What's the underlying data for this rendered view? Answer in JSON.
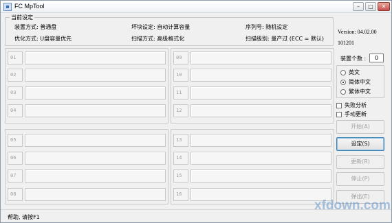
{
  "window": {
    "title": "FC MpTool",
    "controls": {
      "minimize": "–",
      "maximize": "□",
      "close": "✕"
    }
  },
  "settings_group": {
    "legend": "当前设定",
    "install_mode": "装置方式: 普通盘",
    "bad_block": "坏块设定: 自动计算容量",
    "serial": "序列号: 随机设定",
    "optimize": "优化方式: U盘容量优先",
    "scan_mode": "扫描方式: 高级格式化",
    "scan_level": "扫描级别: 量产过 (ECC = 默认)"
  },
  "ports": {
    "left_top": [
      "01",
      "02",
      "03",
      "04"
    ],
    "right_top": [
      "09",
      "10",
      "11",
      "12"
    ],
    "left_bottom": [
      "05",
      "06",
      "07",
      "08"
    ],
    "right_bottom": [
      "13",
      "14",
      "15",
      "16"
    ]
  },
  "right_panel": {
    "version": "Version: 04.02.00",
    "build": "101201",
    "device_count_label": "装置个数 :",
    "device_count": "0",
    "language": {
      "options": [
        "英文",
        "简体中文",
        "繁体中文"
      ],
      "selected": "简体中文"
    },
    "failure_analysis": "失败分析",
    "manual_update": "手动更新",
    "buttons": {
      "start": "开始(A)",
      "settings": "设定(S)",
      "update": "更新(R)",
      "stop": "停止(P)",
      "eject": "弹出(E)"
    }
  },
  "status": {
    "text": "帮助, 请按F1"
  },
  "watermark": "xfdown.com"
}
